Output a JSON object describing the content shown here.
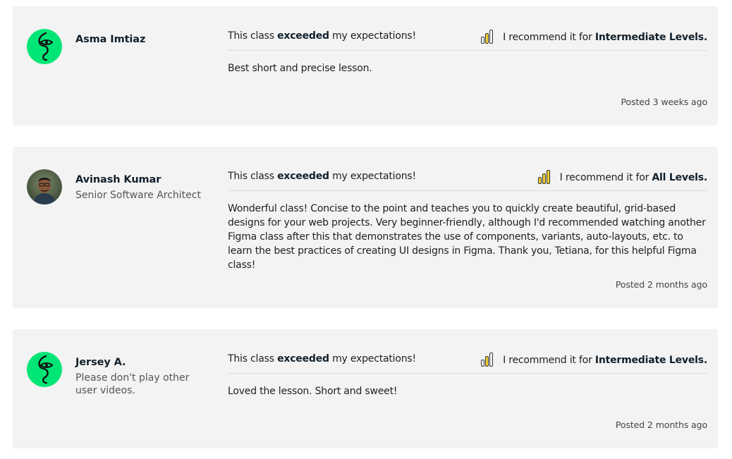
{
  "reviews": [
    {
      "name": "Asma Imtiaz",
      "subtitle": "",
      "avatar": "green-face-avatar",
      "exp_prefix": "This class ",
      "exp_bold": "exceeded",
      "exp_suffix": " my expectations!",
      "rec_prefix": "I recommend it for ",
      "rec_level": "Intermediate Levels.",
      "level_bars_filled": 2,
      "text": "Best short and precise lesson.",
      "posted": "Posted 3 weeks ago"
    },
    {
      "name": "Avinash Kumar",
      "subtitle": "Senior Software Architect",
      "avatar": "photo-avatar",
      "exp_prefix": "This class ",
      "exp_bold": "exceeded",
      "exp_suffix": " my expectations!",
      "rec_prefix": "I recommend it for ",
      "rec_level": "All Levels.",
      "level_bars_filled": 3,
      "text": "Wonderful class! Concise to the point and teaches you to quickly create beautiful, grid-based designs for your web projects. Very beginner-friendly, although I'd recommended watching another Figma class after this that demonstrates the use of components, variants, auto-layouts, etc. to learn the best practices of creating UI designs in Figma. Thank you, Tetiana, for this helpful Figma class!",
      "posted": "Posted 2 months ago"
    },
    {
      "name": "Jersey A.",
      "subtitle": "Please don't play other user videos.",
      "avatar": "green-face-avatar",
      "exp_prefix": "This class ",
      "exp_bold": "exceeded",
      "exp_suffix": " my expectations!",
      "rec_prefix": "I recommend it for ",
      "rec_level": "Intermediate Levels.",
      "level_bars_filled": 2,
      "text": "Loved the lesson. Short and sweet!",
      "posted": "Posted 2 months ago"
    }
  ],
  "colors": {
    "card_bg": "#f3f3f3",
    "avatar_green": "#00e676",
    "level_fill": "#f0cf2c"
  }
}
